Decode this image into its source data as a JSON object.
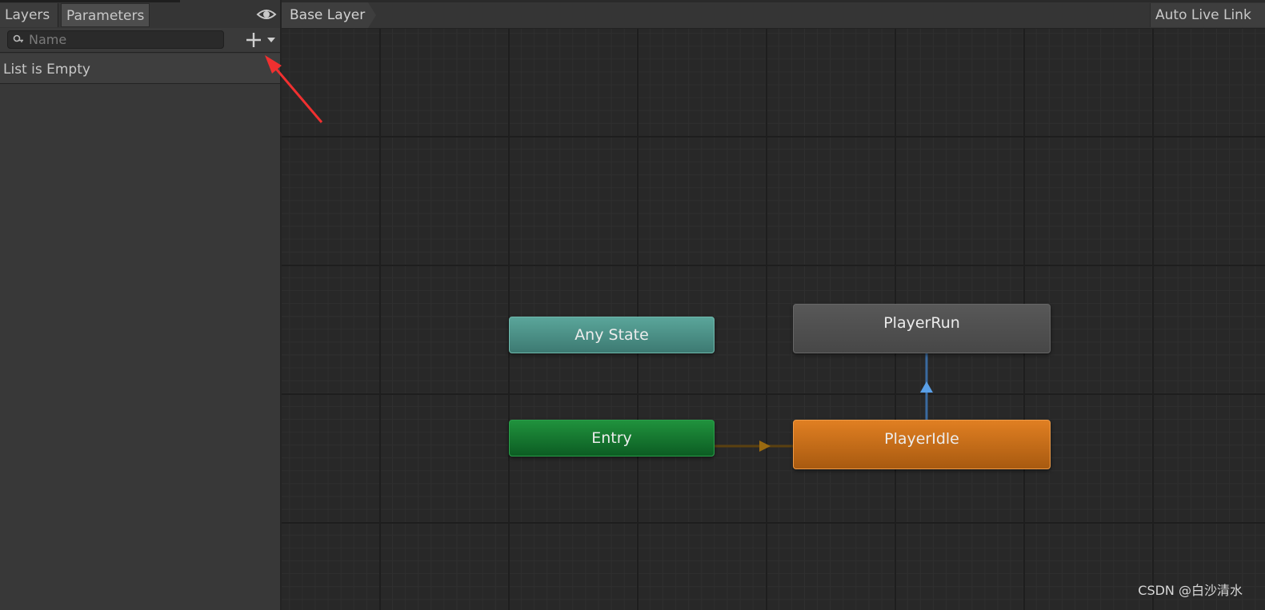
{
  "left_panel": {
    "tabs": [
      {
        "label": "Layers",
        "active": false
      },
      {
        "label": "Parameters",
        "active": true
      }
    ],
    "visibility_icon": "eye-icon",
    "search": {
      "placeholder": "Name",
      "value": "",
      "icon": "search-icon"
    },
    "add_button_icon": "plus-icon",
    "add_menu_icon": "chevron-down-icon",
    "empty_message": "List is Empty"
  },
  "annotation": {
    "color": "#f03030"
  },
  "graph": {
    "breadcrumb": "Base Layer",
    "auto_live_link": "Auto Live Link",
    "states": [
      {
        "name": "Any State",
        "color": "#4d9087"
      },
      {
        "name": "Entry",
        "color": "#167a31"
      },
      {
        "name": "PlayerRun",
        "color": "#505050"
      },
      {
        "name": "PlayerIdle",
        "color": "#c56d18"
      }
    ],
    "transitions": [
      {
        "from": "Entry",
        "to": "PlayerIdle",
        "color": "#9a6a10"
      },
      {
        "from": "PlayerIdle",
        "to": "PlayerRun",
        "color": "#5aa0e8"
      }
    ]
  },
  "watermark": "CSDN @白沙清水"
}
